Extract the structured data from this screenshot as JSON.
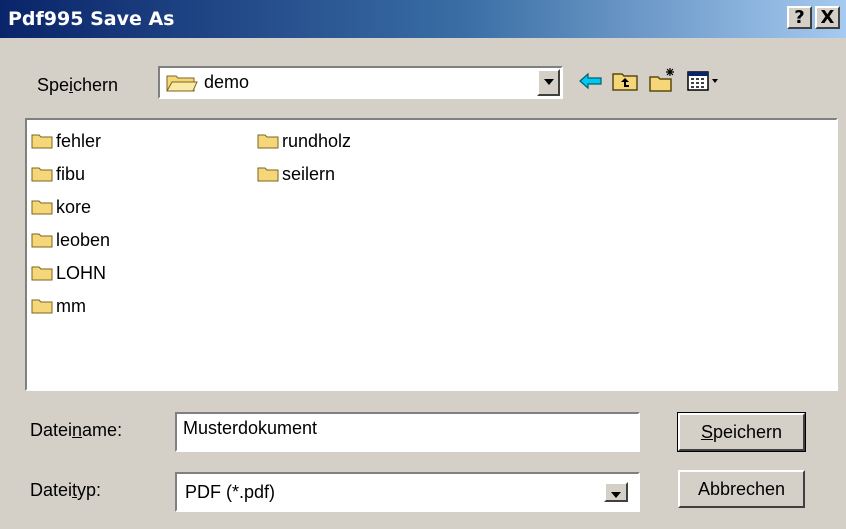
{
  "window": {
    "title": "Pdf995 Save As",
    "help_label": "?",
    "close_label": "X"
  },
  "save_in": {
    "label_pre": "Spe",
    "label_accel": "i",
    "label_post": "chern",
    "value": "demo"
  },
  "files": [
    {
      "name": "fehler"
    },
    {
      "name": "fibu"
    },
    {
      "name": "kore"
    },
    {
      "name": "leoben"
    },
    {
      "name": "LOHN"
    },
    {
      "name": "mm"
    },
    {
      "name": "rundholz"
    },
    {
      "name": "seilern"
    }
  ],
  "filename": {
    "label_pre": "Datei",
    "label_accel": "n",
    "label_post": "ame:",
    "value": "Musterdokument"
  },
  "filetype": {
    "label_pre": "Datei",
    "label_accel": "t",
    "label_post": "yp:",
    "value": "PDF (*.pdf)"
  },
  "buttons": {
    "save": {
      "accel": "S",
      "rest": "peichern"
    },
    "cancel": "Abbrechen"
  },
  "colors": {
    "title_start": "#0a246a",
    "title_end": "#a6caf0",
    "face": "#d4d0c8",
    "folder": "#f5d77a"
  }
}
